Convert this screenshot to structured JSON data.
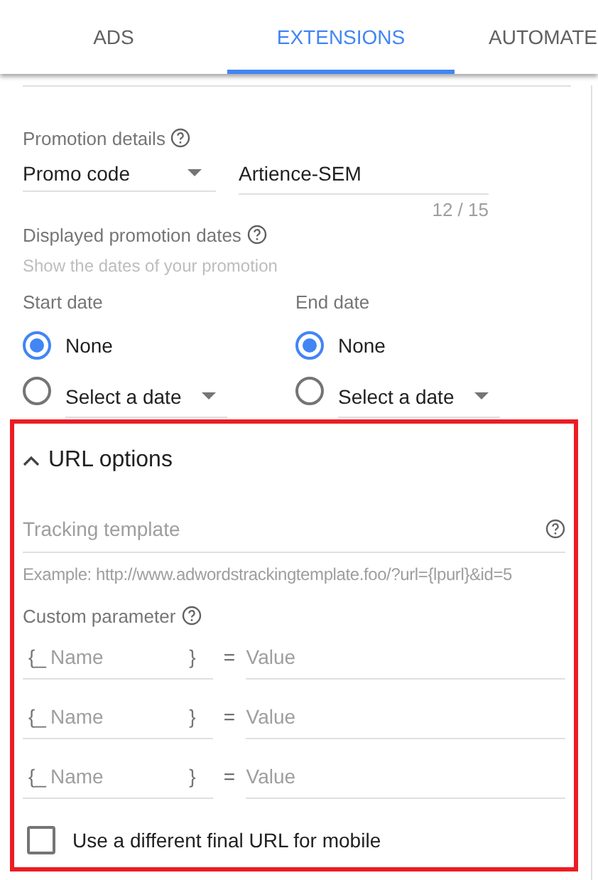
{
  "tabs": [
    {
      "label": "ADS",
      "selected": false
    },
    {
      "label": "EXTENSIONS",
      "selected": true
    },
    {
      "label": "AUTOMATE",
      "selected": false
    }
  ],
  "promotion": {
    "label": "Promotion details",
    "type_value": "Promo code",
    "code_value": "Artience-SEM",
    "counter": "12 / 15"
  },
  "dates": {
    "label": "Displayed promotion dates",
    "hint": "Show the dates of your promotion",
    "columns": [
      {
        "label": "Start date",
        "options": [
          {
            "kind": "plain",
            "label": "None",
            "selected": true
          },
          {
            "kind": "dropdown",
            "label": "Select a date",
            "selected": false
          }
        ]
      },
      {
        "label": "End date",
        "options": [
          {
            "kind": "plain",
            "label": "None",
            "selected": true
          },
          {
            "kind": "dropdown",
            "label": "Select a date",
            "selected": false
          }
        ]
      }
    ]
  },
  "url_options": {
    "title": "URL options",
    "expanded": true,
    "highlighted": true,
    "tracking": {
      "placeholder": "Tracking template"
    },
    "example": "Example: http://www.adwordstrackingtemplate.foo/?url={lpurl}&id=5",
    "custom_label": "Custom parameter",
    "params": [
      {
        "prefix": "{_",
        "name_placeholder": "Name",
        "suffix": "}",
        "equals": "=",
        "value_placeholder": "Value"
      },
      {
        "prefix": "{_",
        "name_placeholder": "Name",
        "suffix": "}",
        "equals": "=",
        "value_placeholder": "Value"
      },
      {
        "prefix": "{_",
        "name_placeholder": "Name",
        "suffix": "}",
        "equals": "=",
        "value_placeholder": "Value"
      }
    ],
    "mobile": {
      "label": "Use a different final URL for mobile",
      "checked": false
    }
  }
}
